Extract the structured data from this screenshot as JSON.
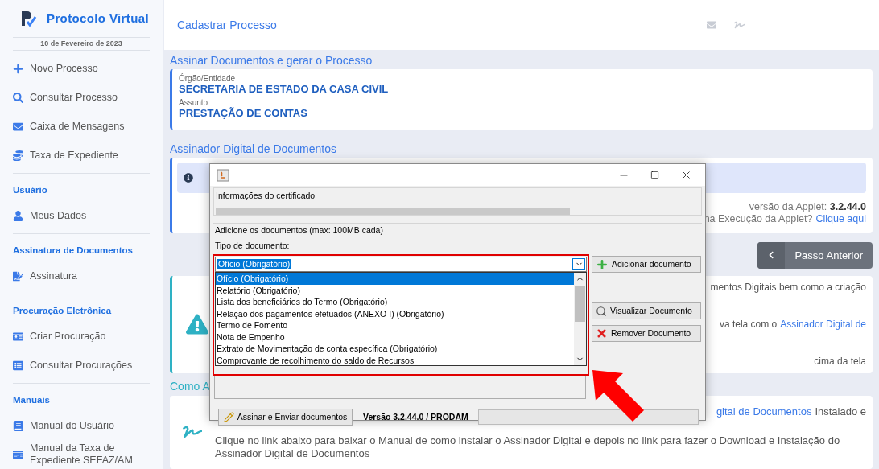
{
  "sidebar": {
    "brand": "Protocolo Virtual",
    "date": "10 de Fevereiro de 2023",
    "groups": [
      {
        "items": [
          "Novo Processo",
          "Consultar Processo",
          "Caixa de Mensagens",
          "Taxa de Expediente"
        ]
      },
      {
        "title": "Usuário",
        "items": [
          "Meus Dados"
        ]
      },
      {
        "title": "Assinatura de Documentos",
        "items": [
          "Assinatura"
        ]
      },
      {
        "title": "Procuração Eletrônica",
        "items": [
          "Criar Procuração",
          "Consultar Procurações"
        ]
      },
      {
        "title": "Manuais",
        "items": [
          "Manual do Usuário",
          "Manual da Taxa de Expediente SEFAZ/AM"
        ]
      }
    ]
  },
  "header": {
    "title": "Cadastrar Processo"
  },
  "process": {
    "heading": "Assinar Documentos e gerar o Processo",
    "fields": [
      {
        "label": "Órgão/Entidade",
        "value": "SECRETARIA DE ESTADO DA CASA CIVIL"
      },
      {
        "label": "Assunto",
        "value": "PRESTAÇÃO DE CONTAS"
      }
    ]
  },
  "signer": {
    "heading": "Assinador Digital de Documentos",
    "version_label": "versão da Applet:",
    "version": "3.2.44.0",
    "help_text": "na Execução da Applet?",
    "help_link": "Clique aqui",
    "back_button": "Passo Anterior",
    "notice_lines": [
      {
        "text": "mentos Digitais bem como a criação"
      },
      {
        "text": "va tela com o",
        "link": "Assinador Digital de"
      },
      {
        "text": "cima da tela"
      }
    ]
  },
  "install": {
    "heading": "Como A",
    "link": "gital de Documentos",
    "text": "Instalado e",
    "paragraph": "Clique no link abaixo para baixar o Manual de como instalar o Assinador Digital e depois no link para fazer o Download e Instalação do Assinador Digital de Documentos"
  },
  "dialog": {
    "cert_group": "Informações do certificado",
    "docs_group": "Adicione os documentos (max: 100MB cada)",
    "type_label": "Tipo de documento:",
    "combo_value": "Ofício (Obrigatório)",
    "options": [
      {
        "label": "Ofício (Obrigatório)",
        "selected": true
      },
      {
        "label": "Relatório (Obrigatório)",
        "selected": false
      },
      {
        "label": "Lista dos beneficiários do Termo (Obrigatório)",
        "selected": false
      },
      {
        "label": "Relação dos pagamentos efetuados (ANEXO I) (Obrigatório)",
        "selected": false
      },
      {
        "label": "Termo de Fomento",
        "selected": false
      },
      {
        "label": "Nota de Empenho",
        "selected": false
      },
      {
        "label": "Extrato de Movimentação de conta específica (Obrigatório)",
        "selected": false
      },
      {
        "label": "Comprovante de recolhimento do saldo de Recursos",
        "selected": false
      }
    ],
    "add_button": "Adicionar documento",
    "view_button": "Visualizar Documento",
    "remove_button": "Remover Documento",
    "sign_button": "Assinar e Enviar documentos",
    "version": "Versão 3.2.44.0 / PRODAM"
  }
}
